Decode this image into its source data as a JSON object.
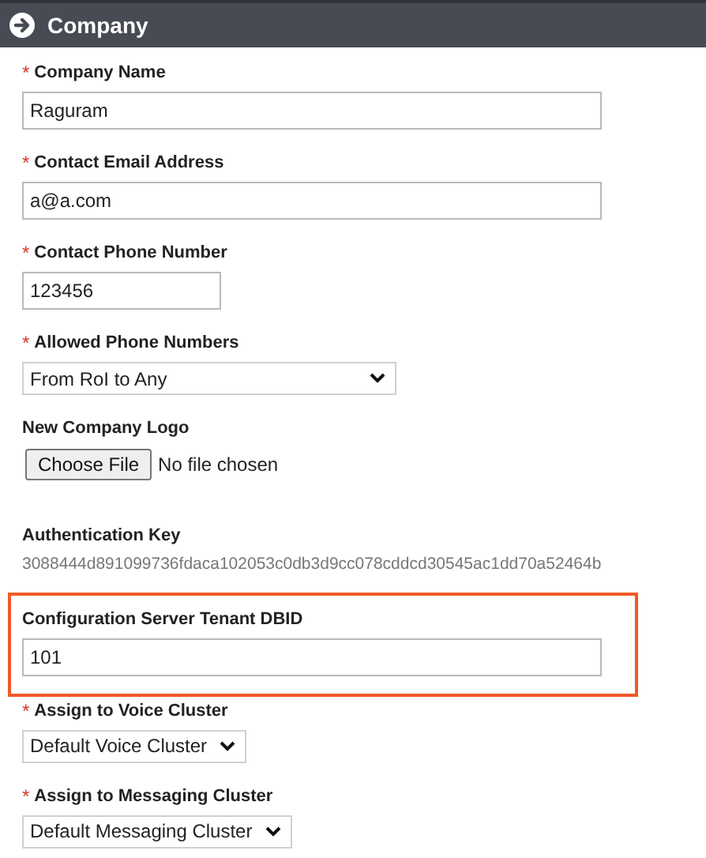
{
  "header": {
    "title": "Company"
  },
  "fields": [
    {
      "kind": "text",
      "required_mark": "*",
      "label": "Company Name",
      "value": "Raguram"
    },
    {
      "kind": "text",
      "required_mark": "*",
      "label": "Contact Email Address",
      "value": "a@a.com"
    },
    {
      "kind": "text",
      "required_mark": "*",
      "label": "Contact Phone Number",
      "value": "123456"
    },
    {
      "kind": "select",
      "required_mark": "*",
      "label": "Allowed Phone Numbers",
      "value": "From RoI to Any"
    },
    {
      "kind": "file",
      "label": "New Company Logo",
      "button": "Choose File",
      "status": "No file chosen"
    },
    {
      "kind": "readonly",
      "label": "Authentication Key",
      "value": "3088444d891099736fdaca102053c0db3d9cc078cddcd30545ac1dd70a52464b"
    },
    {
      "kind": "text",
      "label": "Configuration Server Tenant DBID",
      "value": "101",
      "highlighted": true
    },
    {
      "kind": "select",
      "required_mark": "*",
      "label": "Assign to Voice Cluster",
      "value": "Default Voice Cluster"
    },
    {
      "kind": "select",
      "required_mark": "*",
      "label": "Assign to Messaging Cluster",
      "value": "Default Messaging Cluster"
    }
  ]
}
